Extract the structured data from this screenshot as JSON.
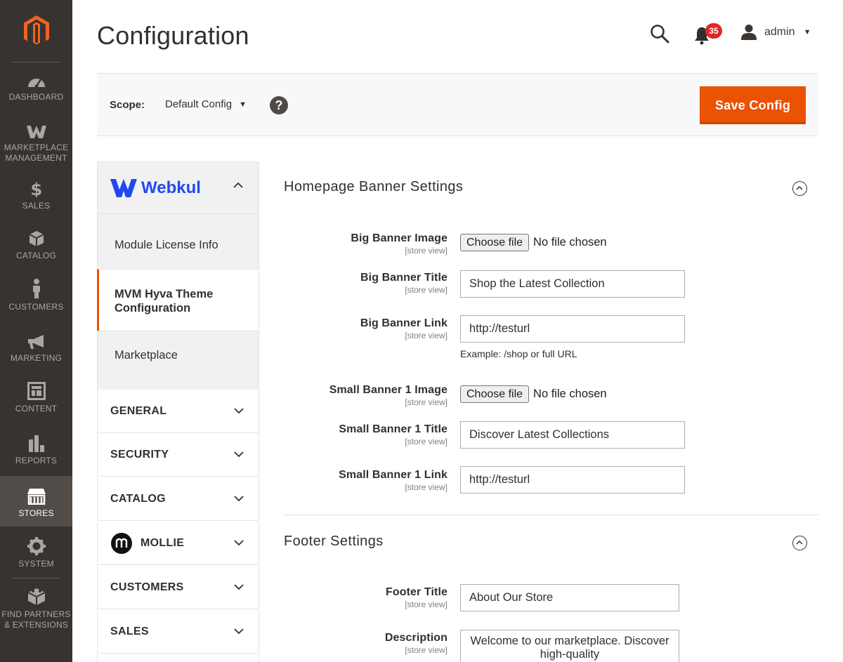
{
  "colors": {
    "nav_bg": "#373330",
    "accent": "#eb5202",
    "badge": "#e22626"
  },
  "nav": {
    "items": [
      {
        "label": "DASHBOARD",
        "icon": "dashboard-icon"
      },
      {
        "label": "MARKETPLACE MANAGEMENT",
        "icon": "marketplace-icon"
      },
      {
        "label": "SALES",
        "icon": "dollar-icon"
      },
      {
        "label": "CATALOG",
        "icon": "cube-icon"
      },
      {
        "label": "CUSTOMERS",
        "icon": "person-icon"
      },
      {
        "label": "MARKETING",
        "icon": "megaphone-icon"
      },
      {
        "label": "CONTENT",
        "icon": "layout-icon"
      },
      {
        "label": "REPORTS",
        "icon": "bar-chart-icon"
      },
      {
        "label": "STORES",
        "icon": "storefront-icon"
      },
      {
        "label": "SYSTEM",
        "icon": "gear-icon"
      },
      {
        "label": "FIND PARTNERS & EXTENSIONS",
        "icon": "blocks-icon"
      }
    ]
  },
  "header": {
    "title": "Configuration",
    "notification_count": "35",
    "user_name": "admin"
  },
  "scope": {
    "label": "Scope:",
    "value": "Default Config",
    "save_label": "Save Config"
  },
  "tabs": {
    "vendor": "Webkul",
    "sub_items": [
      "Module License Info",
      "MVM Hyva Theme Configuration",
      "Marketplace"
    ],
    "groups": [
      "GENERAL",
      "SECURITY",
      "CATALOG",
      "MOLLIE",
      "CUSTOMERS",
      "SALES"
    ]
  },
  "banner": {
    "title": "Homepage Banner Settings",
    "scope_note": "[store view]",
    "big_image_label": "Big Banner Image",
    "choose_file": "Choose file",
    "no_file": "No file chosen",
    "big_title_label": "Big Banner Title",
    "big_title_value": "Shop the Latest Collection",
    "big_link_label": "Big Banner Link",
    "big_link_value": "http://testurl",
    "link_note": "Example: /shop or full URL",
    "small_image_label": "Small Banner 1 Image",
    "small_title_label": "Small Banner 1 Title",
    "small_title_value": "Discover Latest Collections",
    "small_link_label": "Small Banner 1 Link",
    "small_link_value": "http://testurl"
  },
  "footer": {
    "title": "Footer Settings",
    "footer_title_label": "Footer Title",
    "footer_title_value": "About Our Store",
    "description_label": "Description",
    "description_value": "Welcome to our marketplace. Discover high-quality"
  }
}
